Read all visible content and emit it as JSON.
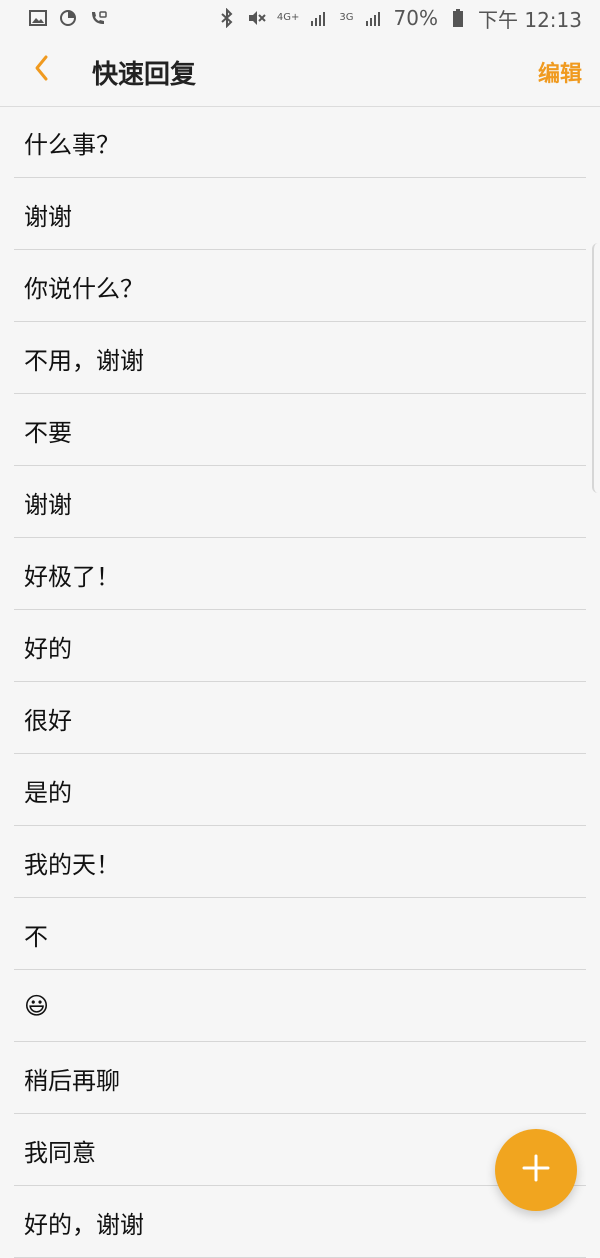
{
  "status_bar": {
    "battery_percent": "70%",
    "time": "下午 12:13",
    "network": "4G+",
    "network2": "3G",
    "icons": [
      "gallery-icon",
      "data-usage-icon",
      "wifi-calling-icon",
      "bluetooth-icon",
      "mute-vibrate-icon",
      "signal-icon",
      "battery-icon"
    ]
  },
  "app_bar": {
    "title": "快速回复",
    "edit_label": "编辑",
    "back_icon": "chevron-left-icon",
    "accent_color": "#f09a1f"
  },
  "replies": [
    "什么事？",
    "谢谢",
    "你说什么？",
    "不用，谢谢",
    "不要",
    "谢谢",
    "好极了！",
    "好的",
    "很好",
    "是的",
    "我的天！",
    "不",
    "😃",
    "稍后再聊",
    "我同意",
    "好的，谢谢"
  ],
  "fab": {
    "icon": "plus-icon",
    "color": "#f1a51f"
  }
}
